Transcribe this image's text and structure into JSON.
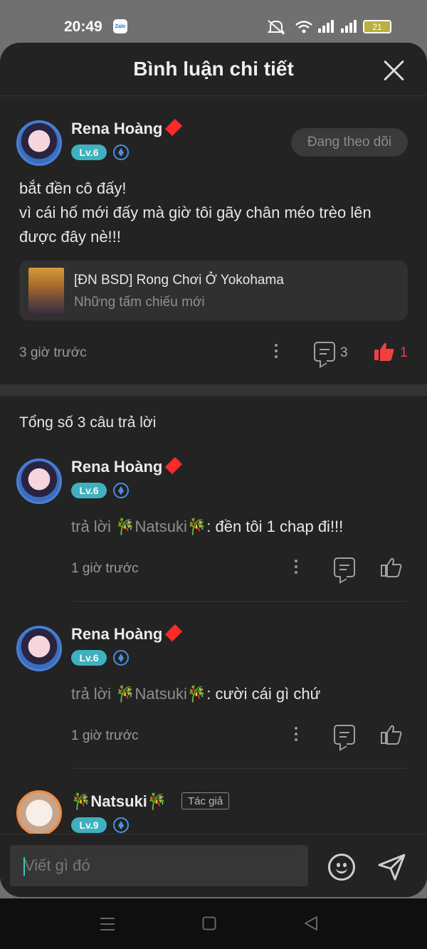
{
  "status": {
    "time": "20:49",
    "app_badge": "Zalo",
    "battery": "21"
  },
  "header": {
    "title": "Bình luận chi tiết"
  },
  "main_comment": {
    "user": "Rena Hoàng",
    "level": "Lv.6",
    "follow_label": "Đang theo dõi",
    "text_line1": "bắt đền cô đấy!",
    "text_line2": "vì cái hố mới đấy mà giờ tôi gãy chân méo trèo lên được đây nè!!!",
    "book_title": "[ĐN BSD] Rong Chơi Ở Yokohama",
    "book_sub": "Những tấm chiếu mới",
    "time": "3 giờ trước",
    "comment_count": "3",
    "like_count": "1"
  },
  "replies_header": "Tổng số 3 câu trả lời",
  "replies": [
    {
      "user": "Rena Hoàng",
      "level": "Lv.6",
      "reply_prefix": "trả lời ",
      "reply_target": "🎋Natsuki🎋",
      "text": ": đền tôi 1 chap đi!!!",
      "time": "1 giờ trước"
    },
    {
      "user": "Rena Hoàng",
      "level": "Lv.6",
      "reply_prefix": "trả lời ",
      "reply_target": "🎋Natsuki🎋",
      "text": ": cười cái gì chứ",
      "time": "1 giờ trước"
    },
    {
      "user": "🎋Natsuki🎋",
      "level": "Lv.9",
      "author_tag": "Tác giả"
    }
  ],
  "input": {
    "placeholder": "Viết gì đó"
  }
}
